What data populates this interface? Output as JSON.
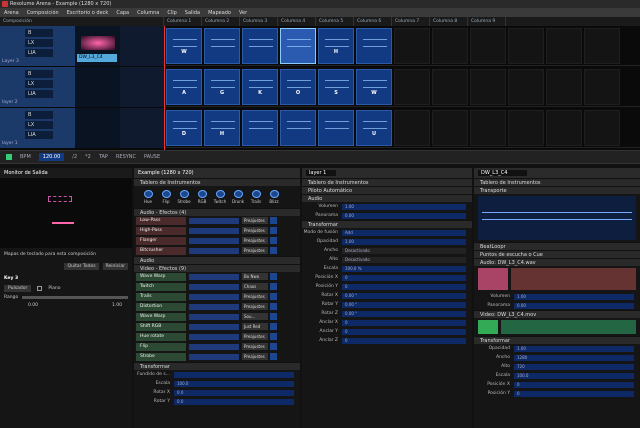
{
  "app": {
    "title": "Resolume Arena - Example (1280 x 720)"
  },
  "menu": [
    "Arena",
    "Composición",
    "Escritorio o deck",
    "Capa",
    "Columna",
    "Clip",
    "Salida",
    "Mapeado",
    "Ver"
  ],
  "columns": [
    "Columna 1",
    "Columna 2",
    "Columna 3",
    "Columna 4",
    "Columna 5",
    "Columna 6",
    "Columna 7",
    "Columna 8",
    "Columna 9"
  ],
  "layers": [
    {
      "name": "Layer 3",
      "buttons": [
        "B",
        "LX",
        "LIA"
      ],
      "clips": [
        "W",
        "",
        "",
        "",
        "H",
        ""
      ],
      "sel": 4
    },
    {
      "name": "layer 2",
      "buttons": [
        "B",
        "LX",
        "LIA"
      ],
      "clips": [
        "A",
        "G",
        "K",
        "O",
        "S",
        "W"
      ],
      "sel": -1
    },
    {
      "name": "layer 1",
      "buttons": [
        "B",
        "LX",
        "LIA"
      ],
      "clips": [
        "D",
        "H",
        "",
        "",
        "",
        "U"
      ],
      "sel": -1
    }
  ],
  "preview_label": "DW_L3_C4",
  "transport": {
    "bpm_label": "BPM",
    "bpm": "120.00",
    "items": [
      "/2",
      "*2",
      "TAP",
      "RESYNC",
      "PAUSE"
    ]
  },
  "left_panel": {
    "title": "Monitor de Salida",
    "mapping": "Mapas de teclado para esta composición",
    "key_title": "Key 3",
    "mode": "Pulsador",
    "piano": "Piano",
    "range_label": "Rango",
    "range_lo": "0.00",
    "range_hi": "1.00",
    "btn1": "Quitar Todos",
    "btn2": "Reiniciar"
  },
  "comp_panel": {
    "title": "Example (1280 x 720)",
    "dashboard": "Tablero de Instrumentos",
    "knobs": [
      "Hue",
      "Flip",
      "Strobe",
      "RGB",
      "Twitch",
      "Drunk",
      "Trails",
      "Blizz"
    ],
    "audio_fx_header": "Audio - Efectos (4)",
    "audio_fx": [
      {
        "name": "Low-Pass",
        "preset": "Preajustes"
      },
      {
        "name": "High-Pass",
        "preset": "Preajustes"
      },
      {
        "name": "Flanger",
        "preset": "Preajustes"
      },
      {
        "name": "Bitcrusher",
        "preset": "Preajustes"
      }
    ],
    "audio": "Audio",
    "video_fx_header": "Video - Efectos (9)",
    "video_fx": [
      {
        "name": "Wave Warp",
        "preset": "Bo Nwo"
      },
      {
        "name": "Twitch",
        "preset": "Chaos"
      },
      {
        "name": "Trails",
        "preset": "Preajustes"
      },
      {
        "name": "Distortion",
        "preset": "Preajustes"
      },
      {
        "name": "Wave Warp",
        "preset": "Sou..."
      },
      {
        "name": "Shift RGB",
        "preset": "Just Red"
      },
      {
        "name": "Hue rotate",
        "preset": "Preajustes"
      },
      {
        "name": "Flip",
        "preset": "Preajustes"
      },
      {
        "name": "Strobe",
        "preset": "Preajustes"
      }
    ],
    "transform": "Transformar",
    "transform_rows": [
      {
        "l": "Fundido de s...",
        "v": ""
      },
      {
        "l": "Escala",
        "v": "100.0"
      },
      {
        "l": "Rotar X",
        "v": "0.0"
      },
      {
        "l": "Rotar Y",
        "v": "0.0"
      }
    ]
  },
  "layer_panel": {
    "title": "layer 1",
    "sections": {
      "dash": "Tablero de Instrumentos",
      "pilot": "Piloto Automático",
      "audio": "Audio",
      "transform": "Transformar"
    },
    "audio_rows": [
      {
        "l": "Volumen",
        "v": "1.00"
      },
      {
        "l": "Panorama",
        "v": "0.00"
      }
    ],
    "fade_label": "Modo de fusión",
    "fade_value": "Add",
    "opacity_label": "Opacidad",
    "opacity": "1.00",
    "extra_rows": [
      {
        "l": "Ancho",
        "v": "Desactivado"
      },
      {
        "l": "Alto",
        "v": "Desactivado"
      }
    ],
    "t_rows": [
      {
        "l": "Escala",
        "v": "100.0 %"
      },
      {
        "l": "Posición X",
        "v": "0"
      },
      {
        "l": "Posición Y",
        "v": "0"
      },
      {
        "l": "Rotar X",
        "v": "0.00 °"
      },
      {
        "l": "Rotar Y",
        "v": "0.00 °"
      },
      {
        "l": "Rotar Z",
        "v": "0.00 °"
      },
      {
        "l": "Anclar X",
        "v": "0"
      },
      {
        "l": "Anclar Y",
        "v": "0"
      },
      {
        "l": "Anclar Z",
        "v": "0"
      }
    ]
  },
  "clip_panel": {
    "title": "DW_L3_C4",
    "sections": {
      "dash": "Tablero de Instrumentos",
      "transport": "Transporte",
      "beatloop": "BeatLoopr",
      "cue": "Puntos de escucha o Cue",
      "audio": "Audio: DW_L3_C4.wav",
      "video": "Video: DW_L3_C4.mov",
      "transform": "Transformar"
    },
    "audio_rows": [
      {
        "l": "Volumen",
        "v": "1.00"
      },
      {
        "l": "Panorama",
        "v": "0.00"
      }
    ],
    "video_rows": [
      {
        "l": "Opacidad",
        "v": "1.00"
      },
      {
        "l": "Ancho",
        "v": "1280"
      },
      {
        "l": "Alto",
        "v": "720"
      },
      {
        "l": "Escala",
        "v": "100.0"
      },
      {
        "l": "Posición X",
        "v": "0"
      },
      {
        "l": "Posición Y",
        "v": "0"
      }
    ]
  }
}
